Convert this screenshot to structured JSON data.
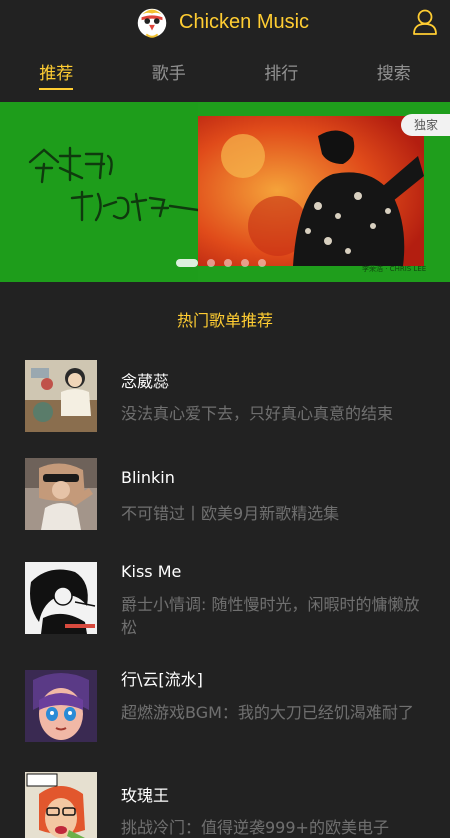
{
  "header": {
    "title": "Chicken Music",
    "logo_icon": "chicken-logo-icon",
    "user_icon": "user-icon",
    "accent": "#ffcd32",
    "background": "#222222"
  },
  "tabs": [
    {
      "label": "推荐",
      "active": true
    },
    {
      "label": "歌手",
      "active": false
    },
    {
      "label": "排行",
      "active": false
    },
    {
      "label": "搜索",
      "active": false
    }
  ],
  "slider": {
    "badge": "独家",
    "credit": "李荣浩 · CHRIS LEE",
    "dot_count": 5,
    "active_dot": 1,
    "background": "#1f9e1c"
  },
  "list": {
    "title": "热门歌单推荐",
    "items": [
      {
        "name": "念葳蕊",
        "desc": "没法真心爱下去，只好真心真意的结束"
      },
      {
        "name": "Blinkin",
        "desc": "不可错过丨欧美9月新歌精选集"
      },
      {
        "name": "Kiss Me",
        "desc": "爵士小情调: 随性慢时光，闲暇时的慵懒放松"
      },
      {
        "name": "行\\云[流水]",
        "desc": "超燃游戏BGM：我的大刀已经饥渴难耐了"
      },
      {
        "name": "玫瑰王",
        "desc": "挑战冷门：值得逆袭999+的欧美电子"
      }
    ]
  }
}
